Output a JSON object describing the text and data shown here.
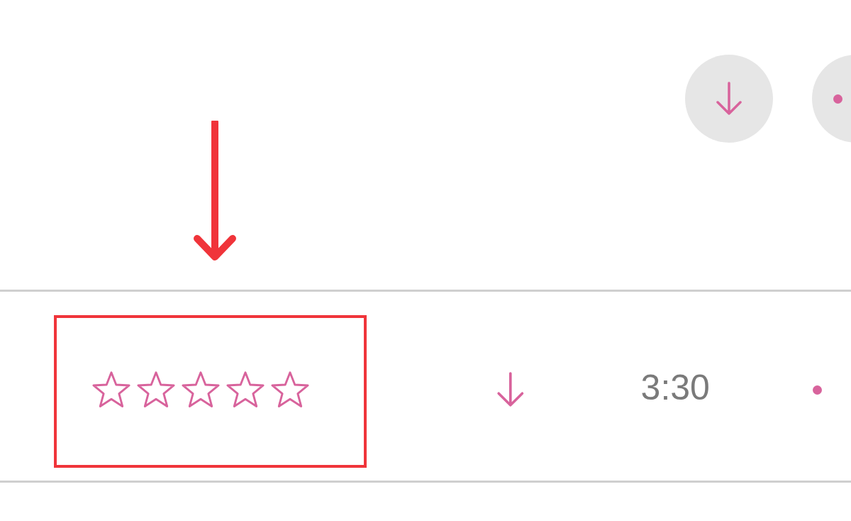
{
  "track": {
    "stars": 0,
    "duration": "3:30"
  }
}
